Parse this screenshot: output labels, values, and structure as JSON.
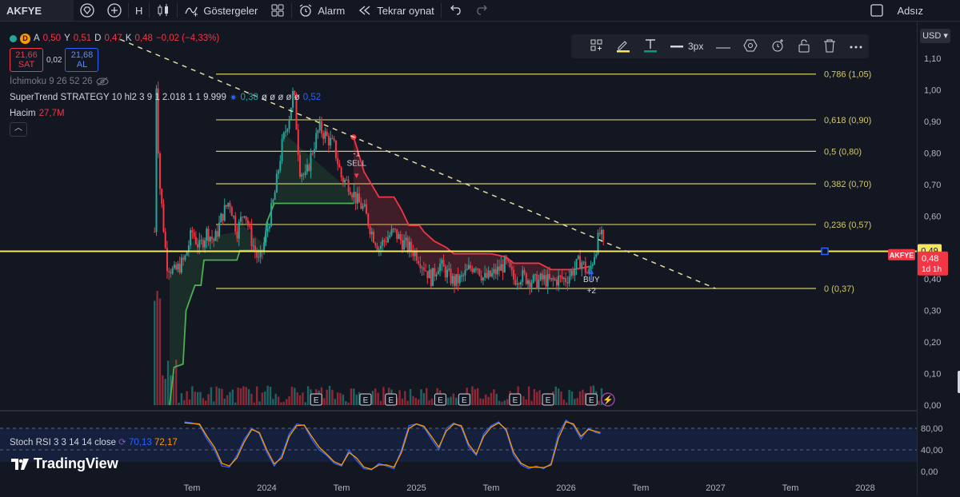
{
  "toolbar": {
    "symbol": "AKFYE",
    "interval": "H",
    "indicators_label": "Göstergeler",
    "alarm_label": "Alarm",
    "replay_label": "Tekrar oynat",
    "layout_name": "Adsız"
  },
  "legend": {
    "symbol_badge": "D",
    "open_label": "A",
    "open": "0,50",
    "high_label": "Y",
    "high": "0,51",
    "low_label": "D",
    "low": "0,47",
    "close_label": "K",
    "close": "0,48",
    "change": "−0,02 (−4,33%)",
    "sell_price": "21,66",
    "sell_label": "SAT",
    "spread": "0,02",
    "buy_price": "21,68",
    "buy_label": "AL",
    "ichimoku": "İchimoku 9 26 52 26",
    "supertrend": "SuperTrend STRATEGY 10 hl2 3 9 1 2.018 1 1 9.999",
    "supertrend_v1": "0,38",
    "supertrend_zeros": "ø ø ø ø ø",
    "supertrend_v2": "0,52",
    "volume_label": "Hacim",
    "volume_value": "27,7M"
  },
  "draw_toolbar": {
    "width_label": "3px"
  },
  "stoch": {
    "label": "Stoch RSI 3 3 14 14 close",
    "k": "70,13",
    "d": "72,17"
  },
  "logo": {
    "text": "TradingView"
  },
  "currency": "USD",
  "colors": {
    "up": "#26a69a",
    "down": "#f23645",
    "fib": "#d4c86a",
    "horizontal": "#f5e663",
    "st_green": "#4caf50",
    "st_red": "#f23645",
    "k_line": "#2962ff",
    "d_line": "#ff9800"
  },
  "chart_data": {
    "type": "candlestick",
    "x_labels": [
      {
        "label": "Tem",
        "t": 0.0
      },
      {
        "label": "2024",
        "t": 0.5
      },
      {
        "label": "Tem",
        "t": 1.0
      },
      {
        "label": "2025",
        "t": 1.5
      },
      {
        "label": "Tem",
        "t": 2.0
      },
      {
        "label": "2026",
        "t": 2.5
      },
      {
        "label": "Tem",
        "t": 3.0
      },
      {
        "label": "2027",
        "t": 3.5
      },
      {
        "label": "Tem",
        "t": 4.0
      },
      {
        "label": "2028",
        "t": 4.5
      }
    ],
    "y_ticks": [
      "1,10",
      "1,00",
      "0,90",
      "0,80",
      "0,70",
      "0,60",
      "0,50",
      "0,40",
      "0,30",
      "0,20",
      "0,10",
      "0,00"
    ],
    "y_tick_values": [
      1.1,
      1.0,
      0.9,
      0.8,
      0.7,
      0.6,
      0.5,
      0.4,
      0.3,
      0.2,
      0.1,
      0.0
    ],
    "ylim": [
      0.0,
      1.1
    ],
    "fib_levels": [
      {
        "label": "0,786 (1,05)",
        "value": 1.05
      },
      {
        "label": "0,618 (0,90)",
        "value": 0.905
      },
      {
        "label": "0,5 (0,80)",
        "value": 0.805
      },
      {
        "label": "0,382 (0,70)",
        "value": 0.702
      },
      {
        "label": "0,236 (0,57)",
        "value": 0.573
      },
      {
        "label": "0 (0,37)",
        "value": 0.37
      }
    ],
    "horizontal_line": 0.488,
    "current_price_label": "0,48",
    "current_price_value": 0.477,
    "horizontal_line_label": "0,49",
    "timer_label": "1d 1h",
    "symbol_tag": "AKFYE",
    "signals": [
      {
        "text": "-1",
        "label": "SELL",
        "t": 1.1
      },
      {
        "text": "+2",
        "label": "BUY",
        "t": 2.67
      }
    ],
    "events": [
      "E",
      "E",
      "E",
      "E",
      "E",
      "E",
      "E",
      "E"
    ],
    "event_t": [
      0.83,
      1.16,
      1.33,
      1.66,
      1.82,
      2.16,
      2.38,
      2.67
    ],
    "price_path": [
      [
        -0.25,
        0.55
      ],
      [
        -0.24,
        1.05
      ],
      [
        -0.22,
        0.72
      ],
      [
        -0.2,
        0.62
      ],
      [
        -0.17,
        0.45
      ],
      [
        -0.12,
        0.42
      ],
      [
        -0.05,
        0.46
      ],
      [
        0.0,
        0.55
      ],
      [
        0.05,
        0.5
      ],
      [
        0.1,
        0.55
      ],
      [
        0.15,
        0.52
      ],
      [
        0.2,
        0.6
      ],
      [
        0.25,
        0.65
      ],
      [
        0.3,
        0.55
      ],
      [
        0.35,
        0.62
      ],
      [
        0.4,
        0.52
      ],
      [
        0.45,
        0.45
      ],
      [
        0.5,
        0.55
      ],
      [
        0.55,
        0.66
      ],
      [
        0.6,
        0.82
      ],
      [
        0.65,
        0.92
      ],
      [
        0.68,
        1.0
      ],
      [
        0.72,
        0.75
      ],
      [
        0.76,
        0.72
      ],
      [
        0.8,
        0.8
      ],
      [
        0.85,
        0.88
      ],
      [
        0.9,
        0.85
      ],
      [
        0.95,
        0.82
      ],
      [
        1.0,
        0.72
      ],
      [
        1.05,
        0.7
      ],
      [
        1.1,
        0.65
      ],
      [
        1.15,
        0.62
      ],
      [
        1.2,
        0.55
      ],
      [
        1.25,
        0.5
      ],
      [
        1.3,
        0.53
      ],
      [
        1.35,
        0.55
      ],
      [
        1.4,
        0.52
      ],
      [
        1.45,
        0.5
      ],
      [
        1.5,
        0.48
      ],
      [
        1.55,
        0.44
      ],
      [
        1.6,
        0.4
      ],
      [
        1.65,
        0.45
      ],
      [
        1.7,
        0.42
      ],
      [
        1.75,
        0.39
      ],
      [
        1.8,
        0.4
      ],
      [
        1.85,
        0.43
      ],
      [
        1.9,
        0.45
      ],
      [
        1.95,
        0.4
      ],
      [
        2.0,
        0.41
      ],
      [
        2.05,
        0.43
      ],
      [
        2.1,
        0.45
      ],
      [
        2.15,
        0.4
      ],
      [
        2.2,
        0.41
      ],
      [
        2.25,
        0.4
      ],
      [
        2.3,
        0.39
      ],
      [
        2.35,
        0.4
      ],
      [
        2.4,
        0.39
      ],
      [
        2.45,
        0.4
      ],
      [
        2.5,
        0.4
      ],
      [
        2.55,
        0.43
      ],
      [
        2.6,
        0.46
      ],
      [
        2.65,
        0.41
      ],
      [
        2.7,
        0.5
      ],
      [
        2.73,
        0.55
      ],
      [
        2.76,
        0.48
      ]
    ],
    "supertrend_green": [
      [
        -0.15,
        0.0
      ],
      [
        -0.12,
        0.12
      ],
      [
        -0.06,
        0.13
      ],
      [
        -0.04,
        0.3
      ],
      [
        0.02,
        0.38
      ],
      [
        0.06,
        0.38
      ],
      [
        0.08,
        0.46
      ],
      [
        0.3,
        0.46
      ],
      [
        0.32,
        0.49
      ],
      [
        0.48,
        0.49
      ],
      [
        0.5,
        0.58
      ],
      [
        0.55,
        0.64
      ],
      [
        0.6,
        0.64
      ],
      [
        0.62,
        0.64
      ],
      [
        1.08,
        0.64
      ]
    ],
    "supertrend_red": [
      [
        1.08,
        0.85
      ],
      [
        1.1,
        0.82
      ],
      [
        1.15,
        0.74
      ],
      [
        1.2,
        0.7
      ],
      [
        1.25,
        0.66
      ],
      [
        1.35,
        0.66
      ],
      [
        1.4,
        0.62
      ],
      [
        1.45,
        0.57
      ],
      [
        1.52,
        0.57
      ],
      [
        1.55,
        0.55
      ],
      [
        1.62,
        0.52
      ],
      [
        1.7,
        0.5
      ],
      [
        1.75,
        0.48
      ],
      [
        1.8,
        0.48
      ],
      [
        1.85,
        0.48
      ],
      [
        2.0,
        0.48
      ],
      [
        2.1,
        0.47
      ],
      [
        2.15,
        0.45
      ],
      [
        2.2,
        0.45
      ],
      [
        2.32,
        0.45
      ],
      [
        2.4,
        0.43
      ],
      [
        2.55,
        0.43
      ],
      [
        2.66,
        0.44
      ]
    ],
    "trendline": {
      "from": [
        -0.48,
        1.16
      ],
      "to": [
        3.5,
        0.37
      ]
    },
    "stoch_ticks": [
      "80,00",
      "40,00",
      "0,00"
    ],
    "stoch_tick_values": [
      80,
      40,
      0
    ],
    "stoch_k": [
      [
        -0.05,
        92
      ],
      [
        0.0,
        90
      ],
      [
        0.05,
        86
      ],
      [
        0.1,
        60
      ],
      [
        0.15,
        40
      ],
      [
        0.2,
        10
      ],
      [
        0.25,
        8
      ],
      [
        0.3,
        30
      ],
      [
        0.35,
        60
      ],
      [
        0.4,
        80
      ],
      [
        0.45,
        70
      ],
      [
        0.5,
        35
      ],
      [
        0.55,
        10
      ],
      [
        0.6,
        30
      ],
      [
        0.65,
        70
      ],
      [
        0.7,
        88
      ],
      [
        0.75,
        85
      ],
      [
        0.8,
        60
      ],
      [
        0.85,
        40
      ],
      [
        0.9,
        30
      ],
      [
        0.95,
        15
      ],
      [
        1.0,
        10
      ],
      [
        1.05,
        40
      ],
      [
        1.1,
        20
      ],
      [
        1.15,
        5
      ],
      [
        1.2,
        3
      ],
      [
        1.25,
        15
      ],
      [
        1.3,
        10
      ],
      [
        1.35,
        5
      ],
      [
        1.4,
        40
      ],
      [
        1.45,
        85
      ],
      [
        1.5,
        88
      ],
      [
        1.55,
        82
      ],
      [
        1.6,
        60
      ],
      [
        1.65,
        40
      ],
      [
        1.7,
        80
      ],
      [
        1.75,
        90
      ],
      [
        1.8,
        82
      ],
      [
        1.85,
        45
      ],
      [
        1.9,
        30
      ],
      [
        1.95,
        70
      ],
      [
        2.0,
        85
      ],
      [
        2.05,
        92
      ],
      [
        2.1,
        75
      ],
      [
        2.15,
        30
      ],
      [
        2.2,
        12
      ],
      [
        2.25,
        5
      ],
      [
        2.3,
        10
      ],
      [
        2.35,
        5
      ],
      [
        2.4,
        15
      ],
      [
        2.45,
        70
      ],
      [
        2.5,
        95
      ],
      [
        2.55,
        85
      ],
      [
        2.6,
        60
      ],
      [
        2.65,
        80
      ],
      [
        2.7,
        72
      ],
      [
        2.73,
        70
      ]
    ],
    "stoch_d": [
      [
        -0.05,
        90
      ],
      [
        0.0,
        89
      ],
      [
        0.05,
        88
      ],
      [
        0.1,
        65
      ],
      [
        0.15,
        45
      ],
      [
        0.2,
        15
      ],
      [
        0.25,
        10
      ],
      [
        0.3,
        25
      ],
      [
        0.35,
        55
      ],
      [
        0.4,
        78
      ],
      [
        0.45,
        72
      ],
      [
        0.5,
        40
      ],
      [
        0.55,
        14
      ],
      [
        0.6,
        25
      ],
      [
        0.65,
        65
      ],
      [
        0.7,
        85
      ],
      [
        0.75,
        86
      ],
      [
        0.8,
        65
      ],
      [
        0.85,
        45
      ],
      [
        0.9,
        32
      ],
      [
        0.95,
        18
      ],
      [
        1.0,
        12
      ],
      [
        1.05,
        35
      ],
      [
        1.1,
        25
      ],
      [
        1.15,
        8
      ],
      [
        1.2,
        4
      ],
      [
        1.25,
        12
      ],
      [
        1.3,
        12
      ],
      [
        1.35,
        8
      ],
      [
        1.4,
        35
      ],
      [
        1.45,
        80
      ],
      [
        1.5,
        88
      ],
      [
        1.55,
        84
      ],
      [
        1.6,
        65
      ],
      [
        1.65,
        45
      ],
      [
        1.7,
        75
      ],
      [
        1.75,
        88
      ],
      [
        1.8,
        85
      ],
      [
        1.85,
        50
      ],
      [
        1.9,
        32
      ],
      [
        1.95,
        65
      ],
      [
        2.0,
        82
      ],
      [
        2.05,
        90
      ],
      [
        2.1,
        78
      ],
      [
        2.15,
        35
      ],
      [
        2.2,
        15
      ],
      [
        2.25,
        8
      ],
      [
        2.3,
        8
      ],
      [
        2.35,
        7
      ],
      [
        2.4,
        12
      ],
      [
        2.45,
        62
      ],
      [
        2.5,
        92
      ],
      [
        2.55,
        88
      ],
      [
        2.6,
        65
      ],
      [
        2.65,
        78
      ],
      [
        2.7,
        74
      ],
      [
        2.73,
        72
      ]
    ]
  }
}
